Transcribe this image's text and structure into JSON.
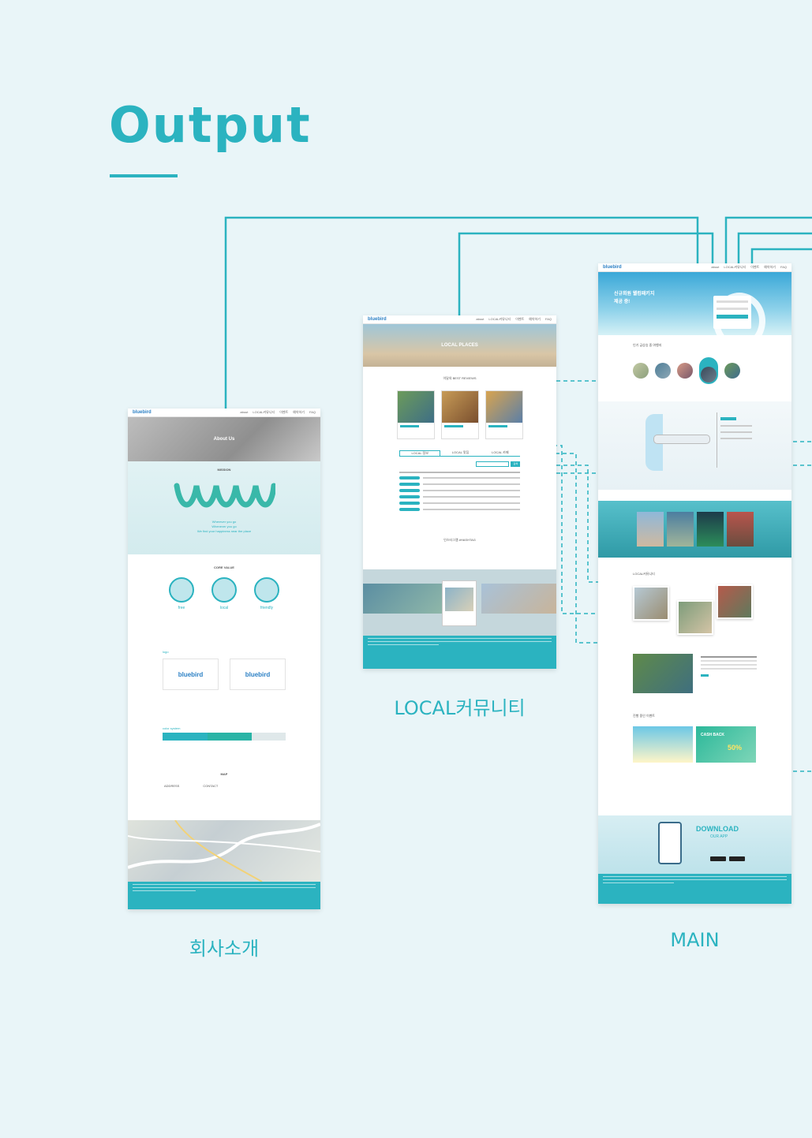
{
  "heading": "Output",
  "labels": {
    "about": "회사소개",
    "local": "LOCAL커뮤니티",
    "main": "MAIN"
  },
  "brand": {
    "logo": "bluebird",
    "nav": [
      "about",
      "LOCAL커뮤니티",
      "이벤트",
      "예약하기",
      "FAQ"
    ]
  },
  "about_page": {
    "hero": "About Us",
    "mission_title": "MISSION",
    "slogan": [
      "Wherever you go",
      "Whenever you go",
      "We find your happiness near the place"
    ],
    "core_title": "CORE VALUE",
    "values": [
      "free",
      "local",
      "friendly"
    ],
    "logo_title": "logo",
    "color_title": "color system",
    "map_title": "MAP",
    "address_title": "ADDRESS",
    "contact_title": "CONTACT"
  },
  "local_page": {
    "hero": "LOCAL PLACES",
    "reviews_title": "이달의 BEST REVIEWS",
    "tabs": [
      "LOCAL 정보",
      "LOCAL 맛집",
      "LOCAL 카페"
    ],
    "photo_title": "인스타그램 #HASHTAG",
    "search_button": "검색"
  },
  "main_page": {
    "hero_line1": "신규회원 웰컴패키지",
    "hero_line2": "제공 중!",
    "popular_title": "인기 급상승 중 여행지",
    "recommend_title": "LOCAL커뮤니티",
    "event_title": "진행 중인 이벤트",
    "download_title": "DOWNLOAD",
    "download_sub": "OUR APP",
    "cashback": "CASH BACK",
    "discount": "50%"
  },
  "colors": {
    "accent": "#2bb3c0",
    "background": "#e9f5f8",
    "brand_blue": "#2a7fc4"
  }
}
